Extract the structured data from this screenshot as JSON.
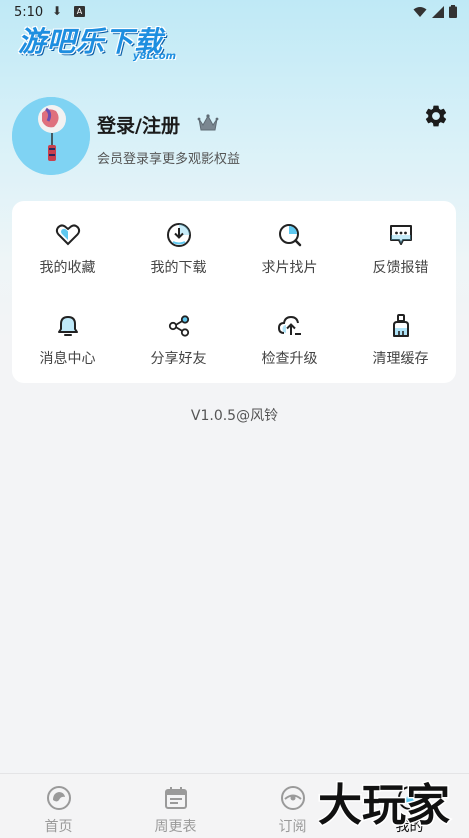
{
  "status_bar": {
    "time": "5:10",
    "download_glyph": "⬇",
    "a_badge": "A"
  },
  "brand": {
    "title": "游吧乐下载",
    "subtitle": "y8Lcom"
  },
  "profile": {
    "login_label": "登录/注册",
    "subtitle": "会员登录享更多观影权益"
  },
  "menu": {
    "items": [
      {
        "label": "我的收藏",
        "icon": "heart-icon"
      },
      {
        "label": "我的下载",
        "icon": "download-icon"
      },
      {
        "label": "求片找片",
        "icon": "search-icon"
      },
      {
        "label": "反馈报错",
        "icon": "feedback-icon"
      },
      {
        "label": "消息中心",
        "icon": "bell-icon"
      },
      {
        "label": "分享好友",
        "icon": "share-icon"
      },
      {
        "label": "检查升级",
        "icon": "cloud-upgrade-icon"
      },
      {
        "label": "清理缓存",
        "icon": "broom-icon"
      }
    ]
  },
  "version": "V1.0.5@风铃",
  "tabbar": {
    "tabs": [
      {
        "label": "首页",
        "icon": "home-icon"
      },
      {
        "label": "周更表",
        "icon": "calendar-icon"
      },
      {
        "label": "订阅",
        "icon": "subscribe-icon"
      },
      {
        "label": "我的",
        "icon": "profile-icon"
      }
    ],
    "active_index": 3
  },
  "watermark": "大玩家",
  "colors": {
    "accent": "#1e8ee0",
    "icon_cyan": "#5fc8ef",
    "icon_dark": "#222222"
  }
}
